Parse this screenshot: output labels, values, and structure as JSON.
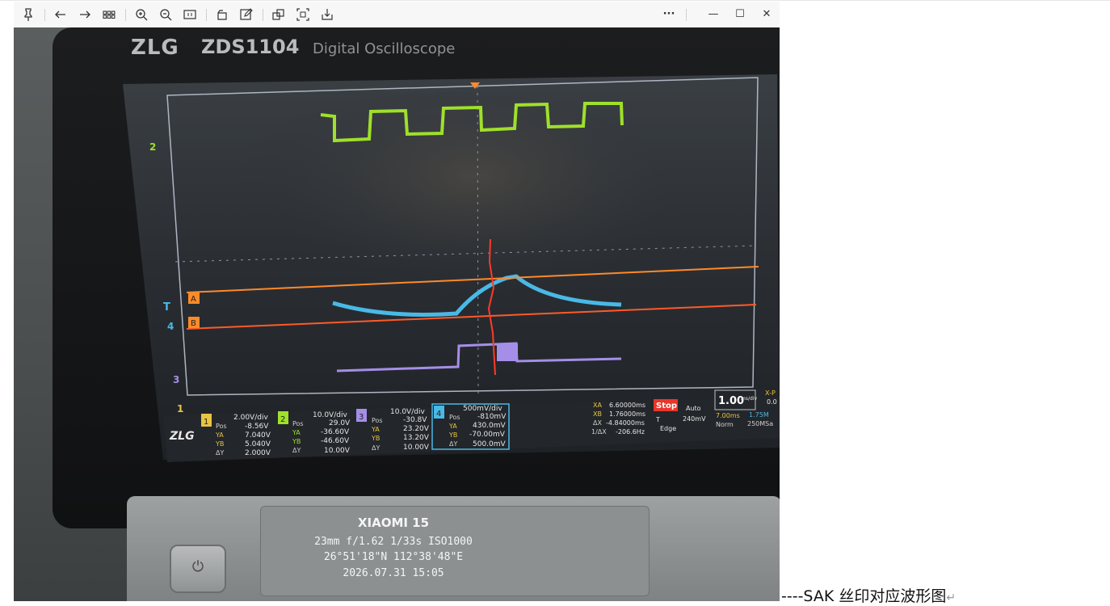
{
  "toolbar": {
    "icons": [
      "pin-icon",
      "back-arrow-icon",
      "forward-arrow-icon",
      "grid-icon",
      "zoom-in-icon",
      "zoom-out-icon",
      "fit-icon",
      "rotate-icon",
      "edit-icon",
      "copy-icon",
      "crop-icon",
      "save-icon",
      "more-icon",
      "minimize-icon",
      "maximize-icon",
      "close-icon"
    ],
    "more": "···",
    "minimize": "—",
    "maximize": "☐",
    "close": "✕"
  },
  "scope": {
    "brand": "ZLG",
    "model": "ZDS1104",
    "subtitle": "Digital Oscilloscope",
    "ch_markers": {
      "ch2": "2",
      "trigger": "T",
      "ch4": "4",
      "ch3": "3",
      "ch1": "1"
    },
    "cursor_labels": {
      "a": "A",
      "b": "B"
    },
    "logo": "ZLG",
    "channels": [
      {
        "num": "1",
        "div": "2.00V/div",
        "pos_label": "Pos",
        "pos": "-8.56V",
        "ya_label": "YA",
        "ya": "7.040V",
        "yb_label": "YB",
        "yb": "5.040V",
        "dy_label": "ΔY",
        "dy": "2.000V"
      },
      {
        "num": "2",
        "div": "10.0V/div",
        "pos_label": "Pos",
        "pos": "29.0V",
        "ya_label": "YA",
        "ya": "-36.60V",
        "yb_label": "YB",
        "yb": "-46.60V",
        "dy_label": "ΔY",
        "dy": "10.00V"
      },
      {
        "num": "3",
        "div": "10.0V/div",
        "pos_label": "Pos",
        "pos": "-30.8V",
        "ya_label": "YA",
        "ya": "23.20V",
        "yb_label": "YB",
        "yb": "13.20V",
        "dy_label": "ΔY",
        "dy": "10.00V"
      },
      {
        "num": "4",
        "div": "500mV/div",
        "pos_label": "Pos",
        "pos": "-810mV",
        "ya_label": "YA",
        "ya": "430.0mV",
        "yb_label": "YB",
        "yb": "-70.00mV",
        "dy_label": "ΔY",
        "dy": "500.0mV"
      }
    ],
    "cursors": {
      "xa_label": "XA",
      "xa": "6.60000ms",
      "xb_label": "XB",
      "xb": "1.76000ms",
      "dx_label": "ΔX",
      "dx": "-4.84000ms",
      "inv_label": "1/ΔX",
      "inv": "-206.6Hz"
    },
    "status": {
      "run": "Stop",
      "mode": "Auto",
      "trig_level_label": "T",
      "trig_level": "240mV",
      "trig_type": "Edge"
    },
    "timebase": {
      "value": "1.00",
      "unit": "ms/div",
      "offset": "7.00ms",
      "rate": "1.75M",
      "norm": "Norm",
      "sample": "250MSa"
    },
    "xp": {
      "label": "X-P",
      "value": "0.0"
    }
  },
  "watermark": {
    "device": "XIAOMI 15",
    "exif": "23mm  f/1.62  1/33s  ISO1000",
    "gps": "26°51'18\"N  112°38'48\"E",
    "datetime": "2026.07.31 15:05"
  },
  "caption": {
    "text": "----SAK 丝印对应波形图",
    "mark": "↵"
  },
  "colors": {
    "ch1": "#e8c440",
    "ch2": "#9fe02a",
    "ch3": "#a58ee8",
    "ch4": "#49b9e6",
    "cursorA": "#ff8a28",
    "cursorB": "#ff5a28",
    "annotation": "#ff3a2a"
  }
}
